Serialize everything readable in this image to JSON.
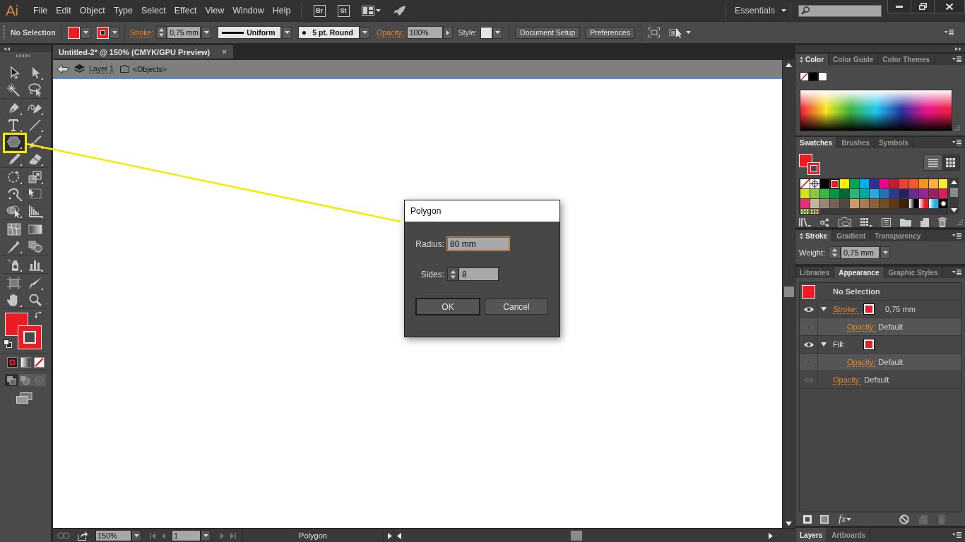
{
  "app": {
    "logo": "Ai",
    "menu": [
      "File",
      "Edit",
      "Object",
      "Type",
      "Select",
      "Effect",
      "View",
      "Window",
      "Help"
    ],
    "launchers": [
      "Br",
      "St"
    ],
    "workspace": "Essentials"
  },
  "control_bar": {
    "selection": "No Selection",
    "fill": {
      "color": "#ed1c24"
    },
    "stroke": {
      "color": "#ed1c24"
    },
    "stroke_label": "Stroke:",
    "stroke_weight": "0,75 mm",
    "profile": "Uniform",
    "brush": "5 pt. Round",
    "opacity_label": "Opacity:",
    "opacity": "100%",
    "style_label": "Style:",
    "buttons": [
      "Document Setup",
      "Preferences"
    ]
  },
  "toolbar": {
    "groups": [
      {
        "tools": [
          {
            "selected": false
          },
          {
            "selected": false
          },
          {
            "selected": false
          },
          {
            "selected": false
          }
        ]
      },
      {
        "tools": [
          {
            "selected": false
          },
          {
            "selected": false
          },
          {
            "selected": false
          },
          {
            "selected": false
          },
          {
            "selected": true
          },
          {
            "selected": false
          },
          {
            "selected": false
          },
          {
            "selected": false
          }
        ]
      },
      {
        "tools": [
          {
            "selected": false
          },
          {
            "selected": false
          },
          {
            "selected": false
          },
          {
            "selected": false
          },
          {
            "selected": false
          },
          {
            "selected": false
          }
        ]
      },
      {
        "tools": [
          {
            "selected": false
          },
          {
            "selected": false
          },
          {
            "selected": false
          },
          {
            "selected": false
          }
        ]
      },
      {
        "tools": [
          {
            "selected": false
          },
          {
            "selected": false
          }
        ]
      },
      {
        "tools": [
          {
            "selected": false
          },
          {
            "selected": false
          },
          {
            "selected": false
          },
          {
            "selected": false
          }
        ]
      }
    ],
    "fill": {
      "color": "#ed1c24"
    },
    "stroke": {
      "color": "#ed1c24"
    },
    "draw_modes": [
      {
        "selected": true
      },
      {
        "selected": false
      },
      {
        "selected": false
      }
    ]
  },
  "document": {
    "tab": {
      "title": "Untitled-2* @ 150% (CMYK/GPU Preview)",
      "close": "×"
    },
    "breadcrumb": {
      "layer": "Layer 1",
      "group": "<Objects>"
    },
    "status_bar": {
      "zoom": "150%",
      "artboard": "1",
      "info": "Polygon"
    }
  },
  "dialog": {
    "title": "Polygon",
    "fields": [
      {
        "kind": "text",
        "label": "Radius:",
        "value": "80 mm",
        "focused": true
      },
      {
        "kind": "spinner",
        "label": "Sides:",
        "value": "8",
        "focused": false
      }
    ],
    "buttons": [
      {
        "label": "OK",
        "default": true
      },
      {
        "label": "Cancel",
        "default": false
      }
    ]
  },
  "panels": {
    "color": {
      "options_toggle": true,
      "tabs": [
        {
          "label": "Color",
          "selected": true
        },
        {
          "label": "Color Guide",
          "selected": false
        },
        {
          "label": "Color Themes",
          "selected": false
        }
      ],
      "quick_swatches": [
        {
          "kind": "none"
        },
        {
          "kind": "solid",
          "color": "#000000"
        },
        {
          "kind": "solid",
          "color": "#ffffff"
        }
      ]
    },
    "swatches": {
      "tabs": [
        {
          "label": "Swatches",
          "selected": true
        },
        {
          "label": "Brushes",
          "selected": false
        },
        {
          "label": "Symbols",
          "selected": false
        }
      ],
      "fill": {
        "color": "#ed1c24"
      },
      "stroke": {
        "color": "#ed1c24"
      },
      "views": [
        {
          "selected": false
        },
        {
          "selected": true
        }
      ],
      "items": [
        {
          "kind": "none",
          "selected": false
        },
        {
          "kind": "registration",
          "selected": false
        },
        {
          "kind": "solid",
          "color": "#000000",
          "selected": false
        },
        {
          "kind": "solid",
          "color": "#ed1c24",
          "selected": true
        },
        {
          "kind": "solid",
          "color": "#fff200",
          "selected": false
        },
        {
          "kind": "solid",
          "color": "#00a651",
          "selected": false
        },
        {
          "kind": "solid",
          "color": "#00aeef",
          "selected": false
        },
        {
          "kind": "solid",
          "color": "#2e3192",
          "selected": false
        },
        {
          "kind": "solid",
          "color": "#ec008c",
          "selected": false
        },
        {
          "kind": "solid",
          "color": "#be1e2d",
          "selected": false
        },
        {
          "kind": "solid",
          "color": "#ef4136",
          "selected": false
        },
        {
          "kind": "solid",
          "color": "#f15a29",
          "selected": false
        },
        {
          "kind": "solid",
          "color": "#f7941d",
          "selected": false
        },
        {
          "kind": "solid",
          "color": "#fbb040",
          "selected": false
        },
        {
          "kind": "solid",
          "color": "#f9ed32",
          "selected": false
        },
        {
          "kind": "solid",
          "color": "#d7df23",
          "selected": false
        },
        {
          "kind": "solid",
          "color": "#8dc63f",
          "selected": false
        },
        {
          "kind": "solid",
          "color": "#39b54a",
          "selected": false
        },
        {
          "kind": "solid",
          "color": "#009444",
          "selected": false
        },
        {
          "kind": "solid",
          "color": "#006838",
          "selected": false
        },
        {
          "kind": "solid",
          "color": "#2bb673",
          "selected": false
        },
        {
          "kind": "solid",
          "color": "#00a79d",
          "selected": false
        },
        {
          "kind": "solid",
          "color": "#27aae1",
          "selected": false
        },
        {
          "kind": "solid",
          "color": "#1c75bc",
          "selected": false
        },
        {
          "kind": "solid",
          "color": "#2b3990",
          "selected": false
        },
        {
          "kind": "solid",
          "color": "#262262",
          "selected": false
        },
        {
          "kind": "solid",
          "color": "#662d91",
          "selected": false
        },
        {
          "kind": "solid",
          "color": "#92278f",
          "selected": false
        },
        {
          "kind": "solid",
          "color": "#9e1f63",
          "selected": false
        },
        {
          "kind": "solid",
          "color": "#da1c5c",
          "selected": false
        },
        {
          "kind": "solid",
          "color": "#ee2a7b",
          "selected": false
        },
        {
          "kind": "solid",
          "color": "#c2b59b",
          "selected": false
        },
        {
          "kind": "solid",
          "color": "#998675",
          "selected": false
        },
        {
          "kind": "solid",
          "color": "#736357",
          "selected": false
        },
        {
          "kind": "solid",
          "color": "#534741",
          "selected": false
        },
        {
          "kind": "solid",
          "color": "#c69c6d",
          "selected": false
        },
        {
          "kind": "solid",
          "color": "#a67c52",
          "selected": false
        },
        {
          "kind": "solid",
          "color": "#8c6239",
          "selected": false
        },
        {
          "kind": "solid",
          "color": "#754c24",
          "selected": false
        },
        {
          "kind": "solid",
          "color": "#603813",
          "selected": false
        },
        {
          "kind": "solid",
          "color": "#42210b",
          "selected": false
        },
        {
          "kind": "gradient",
          "color": "#000000",
          "selected": false
        },
        {
          "kind": "gradient",
          "color": "#ed1c24",
          "selected": false
        },
        {
          "kind": "gradient",
          "color": "#29abe2",
          "selected": false
        },
        {
          "kind": "radial",
          "color": "#000000",
          "selected": false
        },
        {
          "kind": "pattern",
          "color": "#5f9a2c",
          "selected": false
        },
        {
          "kind": "pattern",
          "color": "#8a6546",
          "selected": false
        }
      ]
    },
    "stroke": {
      "options_toggle": true,
      "tabs": [
        {
          "label": "Stroke",
          "selected": true
        },
        {
          "label": "Gradient",
          "selected": false
        },
        {
          "label": "Transparency",
          "selected": false
        }
      ],
      "weight_label": "Weight:",
      "weight": "0,75 mm"
    },
    "appearance": {
      "tabs": [
        {
          "label": "Libraries",
          "selected": false
        },
        {
          "label": "Appearance",
          "selected": true
        },
        {
          "label": "Graphic Styles",
          "selected": false
        }
      ],
      "header": {
        "title": "No Selection",
        "fill": {
          "color": "#ed1c24"
        }
      },
      "rows": [
        {
          "kind": "stroke",
          "label": "Stroke:",
          "visible": true,
          "expanded": true,
          "color": "#ed1c24",
          "value": "0,75 mm",
          "children": [
            {
              "kind": "opacity",
              "label": "Opacity:",
              "value": "Default",
              "visible": false
            }
          ]
        },
        {
          "kind": "fill",
          "label": "Fill:",
          "visible": true,
          "expanded": true,
          "color": "#ed1c24",
          "children": [
            {
              "kind": "opacity",
              "label": "Opacity:",
              "value": "Default",
              "visible": false
            }
          ]
        },
        {
          "kind": "opacity",
          "label": "Opacity:",
          "value": "Default",
          "visible": false
        }
      ],
      "effects_button": "fx"
    },
    "layers": {
      "tabs": [
        {
          "label": "Layers",
          "selected": true
        },
        {
          "label": "Artboards",
          "selected": false
        }
      ]
    }
  }
}
